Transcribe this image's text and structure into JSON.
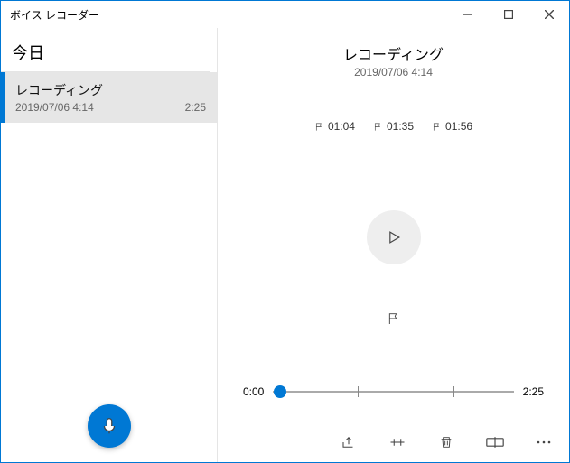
{
  "app": {
    "title": "ボイス レコーダー"
  },
  "sidebar": {
    "section": "今日",
    "items": [
      {
        "title": "レコーディング",
        "timestamp": "2019/07/06 4:14",
        "duration": "2:25",
        "selected": true
      }
    ]
  },
  "recording": {
    "title": "レコーディング",
    "timestamp": "2019/07/06 4:14",
    "markers": [
      "01:04",
      "01:35",
      "01:56"
    ],
    "progress": {
      "start": "0:00",
      "end": "2:25",
      "position_pct": 3
    },
    "ticks_pct": [
      35,
      55,
      75
    ]
  },
  "icons": {
    "minimize": "minimize-icon",
    "maximize": "maximize-icon",
    "close": "close-icon",
    "mic": "mic-icon",
    "flag": "flag-icon",
    "play": "play-icon",
    "share": "share-icon",
    "trim": "trim-icon",
    "delete": "delete-icon",
    "rename": "rename-icon",
    "more": "more-icon"
  }
}
